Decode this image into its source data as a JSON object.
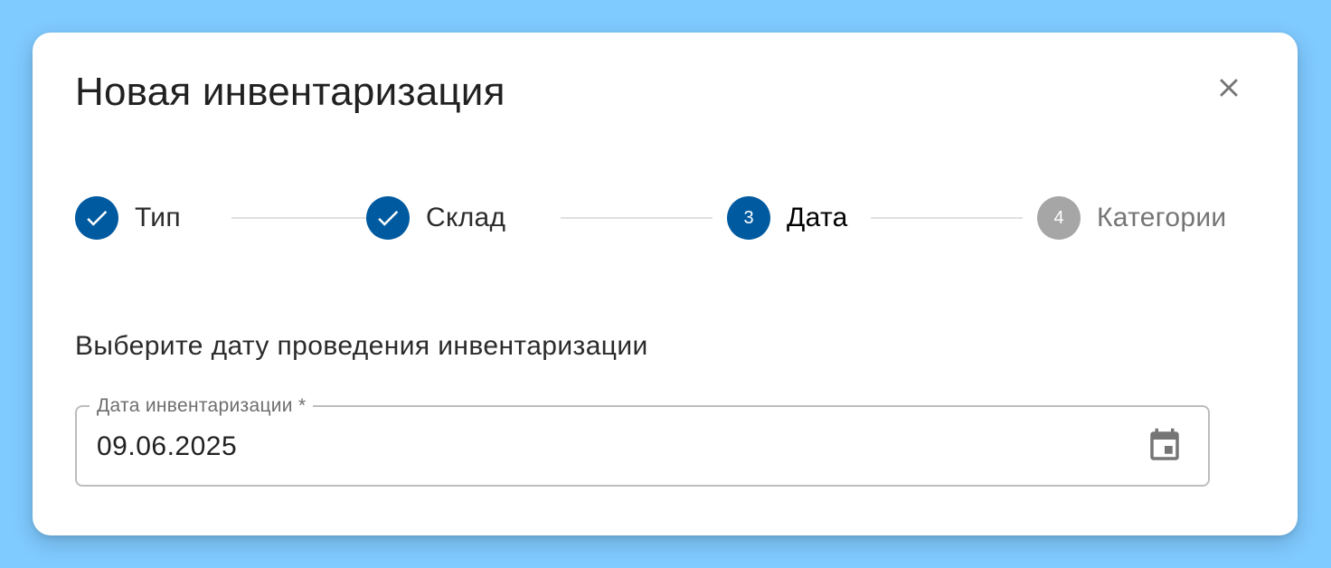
{
  "dialog": {
    "title": "Новая инвентаризация"
  },
  "stepper": {
    "steps": [
      {
        "label": "Тип",
        "number": "1",
        "state": "done"
      },
      {
        "label": "Склад",
        "number": "2",
        "state": "done"
      },
      {
        "label": "Дата",
        "number": "3",
        "state": "active"
      },
      {
        "label": "Категории",
        "number": "4",
        "state": "pending"
      }
    ]
  },
  "content": {
    "prompt": "Выберите дату проведения инвентаризации",
    "date_field": {
      "label": "Дата инвентаризации *",
      "value": "09.06.2025"
    }
  },
  "colors": {
    "primary": "#005aa0",
    "pending": "#a6a6a6",
    "background": "#7fcaff"
  },
  "icons": {
    "close": "close-icon",
    "check": "check-icon",
    "calendar": "calendar-icon"
  }
}
